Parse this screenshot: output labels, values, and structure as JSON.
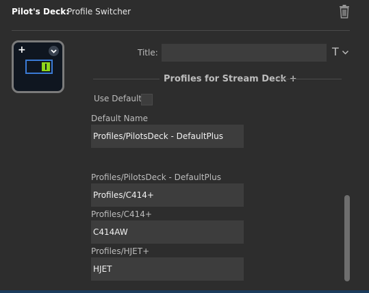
{
  "header": {
    "plugin_name": "Pilot's Deck:",
    "action_name": "Profile Switcher",
    "delete_icon": "trash-icon"
  },
  "key_preview": {
    "plus_label": "+",
    "plus_icon": "plus-icon",
    "menu_icon": "chevron-down-icon",
    "glyph_icon": "switch-icon",
    "accent_blue": "#3b7bd6",
    "accent_green": "#8fd61a"
  },
  "title_field": {
    "label": "Title:",
    "value": "",
    "format_label": "T",
    "format_icon": "text-format-icon"
  },
  "section": {
    "title": "Profiles for Stream Deck +"
  },
  "use_default": {
    "label": "Use Default",
    "checked": false
  },
  "default_name": {
    "label": "Default Name",
    "value": "Profiles/PilotsDeck - DefaultPlus"
  },
  "profiles": [
    {
      "label": "Profiles/PilotsDeck - DefaultPlus",
      "value": "Profiles/C414+"
    },
    {
      "label": "Profiles/C414+",
      "value": "C414AW"
    },
    {
      "label": "Profiles/HJET+",
      "value": "HJET"
    }
  ]
}
